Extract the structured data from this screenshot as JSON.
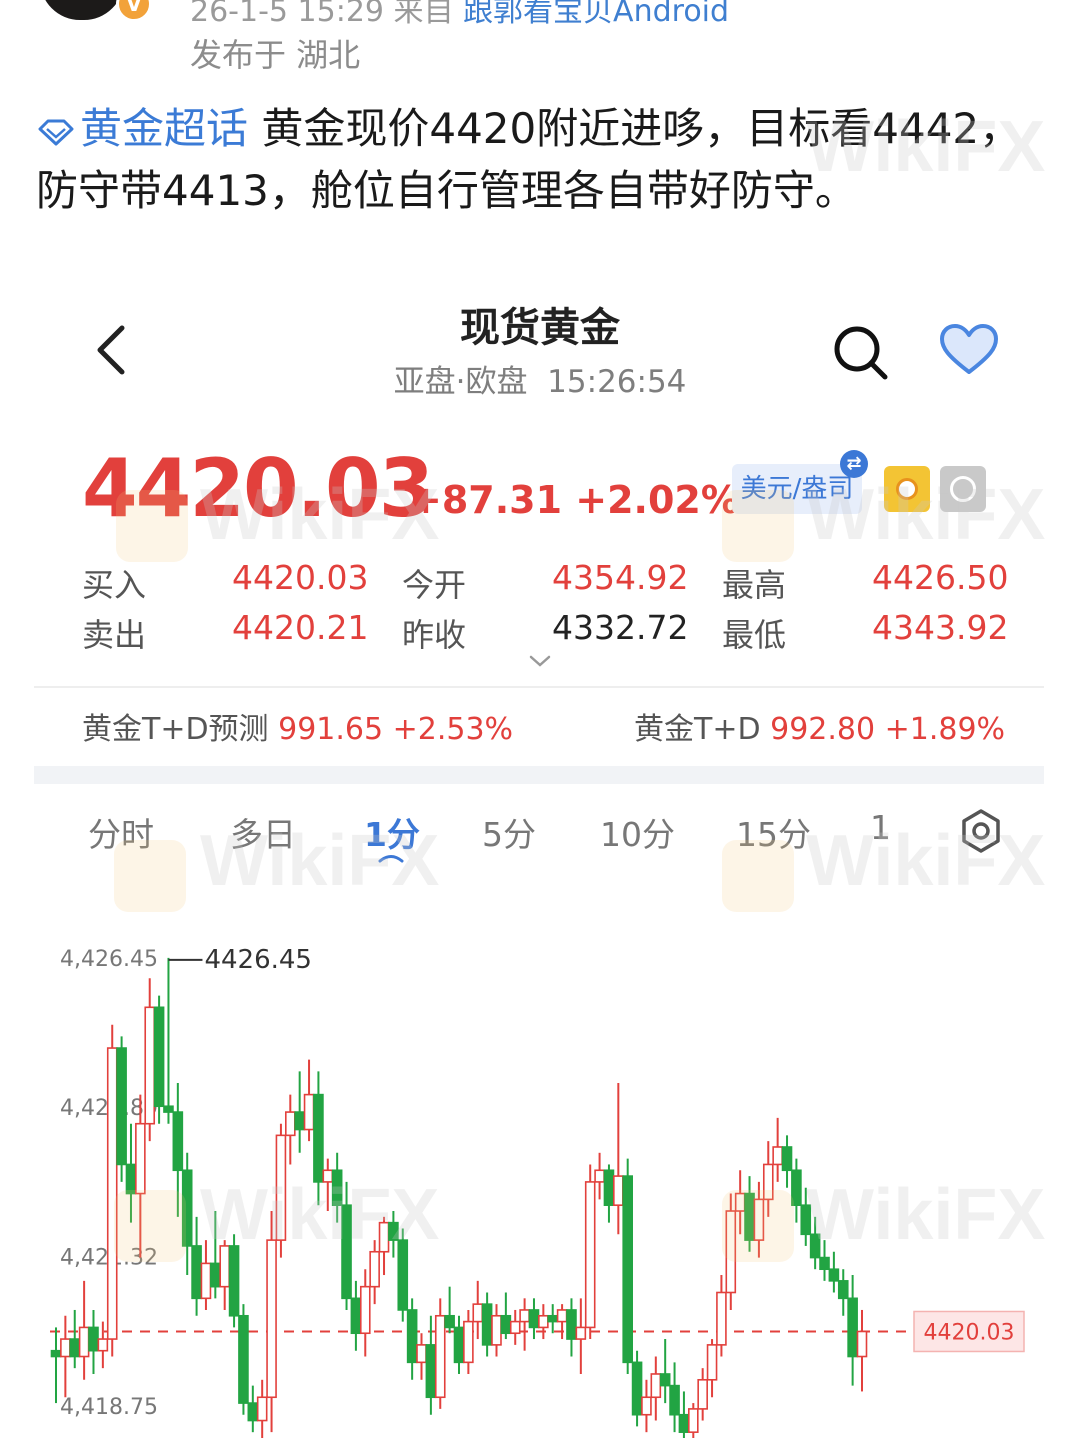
{
  "post": {
    "meta_top_prefix": "26-1-5 15:29  来自 ",
    "meta_top_source": "跟郭看宝贝Android",
    "location": "发布于 湖北",
    "topic": "黄金超话",
    "content": " 黄金现价4420附近进哆，目标看4442，防守带4413，舱位自行管理各自带好防守。"
  },
  "screen": {
    "title": "现货黄金",
    "session": "亚盘·欧盘",
    "time": "15:26:54",
    "price": "4420.03",
    "change": "+87.31 +2.02%",
    "unit": "美元/盎司",
    "quotes": {
      "buy_label": "买入",
      "buy": "4420.03",
      "sell_label": "卖出",
      "sell": "4420.21",
      "open_label": "今开",
      "open": "4354.92",
      "prev_close_label": "昨收",
      "prev_close": "4332.72",
      "high_label": "最高",
      "high": "4426.50",
      "low_label": "最低",
      "low": "4343.92"
    },
    "td_forecast_label": "黄金T+D预测",
    "td_forecast": "991.65 +2.53%",
    "td_label": "黄金T+D",
    "td": "992.80 +1.89%",
    "tabs": [
      "分时",
      "多日",
      "1分",
      "5分",
      "10分",
      "15分",
      "1"
    ],
    "active_tab": "1分"
  },
  "watermark": "WikiFX",
  "colors": {
    "up": "#e2403c",
    "down": "#22a443",
    "accent": "#3c78d6"
  },
  "chart_data": {
    "type": "candlestick",
    "y_ticks": [
      "4,426.45",
      "4,423.89",
      "4,421.32",
      "4,418.75"
    ],
    "ylim": [
      4418.2,
      4427.1
    ],
    "max_label": "4426.45",
    "current_label": "4420.03",
    "current": 4420.03,
    "candles": [
      {
        "o": 4419.7,
        "h": 4420.1,
        "l": 4418.8,
        "c": 4419.6
      },
      {
        "o": 4419.6,
        "h": 4420.3,
        "l": 4418.9,
        "c": 4419.9
      },
      {
        "o": 4419.9,
        "h": 4420.4,
        "l": 4419.4,
        "c": 4419.6
      },
      {
        "o": 4419.6,
        "h": 4420.9,
        "l": 4419.2,
        "c": 4420.1
      },
      {
        "o": 4420.1,
        "h": 4420.4,
        "l": 4419.3,
        "c": 4419.7
      },
      {
        "o": 4419.7,
        "h": 4420.2,
        "l": 4419.4,
        "c": 4419.9
      },
      {
        "o": 4419.9,
        "h": 4425.3,
        "l": 4419.6,
        "c": 4424.9
      },
      {
        "o": 4424.9,
        "h": 4425.1,
        "l": 4422.6,
        "c": 4422.9
      },
      {
        "o": 4422.9,
        "h": 4423.6,
        "l": 4421.9,
        "c": 4422.4
      },
      {
        "o": 4422.4,
        "h": 4424.1,
        "l": 4421.3,
        "c": 4423.6
      },
      {
        "o": 4423.6,
        "h": 4426.1,
        "l": 4423.3,
        "c": 4425.6
      },
      {
        "o": 4425.6,
        "h": 4425.8,
        "l": 4423.6,
        "c": 4423.9
      },
      {
        "o": 4423.9,
        "h": 4426.45,
        "l": 4423.6,
        "c": 4423.8
      },
      {
        "o": 4423.8,
        "h": 4424.3,
        "l": 4422.0,
        "c": 4422.8
      },
      {
        "o": 4422.8,
        "h": 4423.1,
        "l": 4421.0,
        "c": 4421.5
      },
      {
        "o": 4421.5,
        "h": 4422.0,
        "l": 4420.3,
        "c": 4420.6
      },
      {
        "o": 4420.6,
        "h": 4421.6,
        "l": 4420.4,
        "c": 4421.2
      },
      {
        "o": 4421.2,
        "h": 4422.1,
        "l": 4420.6,
        "c": 4420.8
      },
      {
        "o": 4420.8,
        "h": 4421.6,
        "l": 4420.4,
        "c": 4421.5
      },
      {
        "o": 4421.5,
        "h": 4421.7,
        "l": 4420.1,
        "c": 4420.3
      },
      {
        "o": 4420.3,
        "h": 4420.5,
        "l": 4418.6,
        "c": 4418.8
      },
      {
        "o": 4418.8,
        "h": 4419.1,
        "l": 4418.3,
        "c": 4418.5
      },
      {
        "o": 4418.5,
        "h": 4419.2,
        "l": 4418.2,
        "c": 4418.9
      },
      {
        "o": 4418.9,
        "h": 4422.1,
        "l": 4418.3,
        "c": 4421.6
      },
      {
        "o": 4421.6,
        "h": 4423.6,
        "l": 4421.3,
        "c": 4423.4
      },
      {
        "o": 4423.4,
        "h": 4424.1,
        "l": 4422.9,
        "c": 4423.8
      },
      {
        "o": 4423.8,
        "h": 4424.5,
        "l": 4423.1,
        "c": 4423.5
      },
      {
        "o": 4423.5,
        "h": 4424.7,
        "l": 4423.3,
        "c": 4424.1
      },
      {
        "o": 4424.1,
        "h": 4424.5,
        "l": 4422.2,
        "c": 4422.6
      },
      {
        "o": 4422.6,
        "h": 4423.0,
        "l": 4422.1,
        "c": 4422.8
      },
      {
        "o": 4422.8,
        "h": 4423.1,
        "l": 4421.9,
        "c": 4422.2
      },
      {
        "o": 4422.2,
        "h": 4422.6,
        "l": 4420.4,
        "c": 4420.6
      },
      {
        "o": 4420.6,
        "h": 4420.9,
        "l": 4419.7,
        "c": 4420.0
      },
      {
        "o": 4420.0,
        "h": 4421.1,
        "l": 4419.6,
        "c": 4420.8
      },
      {
        "o": 4420.8,
        "h": 4421.6,
        "l": 4420.5,
        "c": 4421.4
      },
      {
        "o": 4421.4,
        "h": 4422.0,
        "l": 4421.0,
        "c": 4421.9
      },
      {
        "o": 4421.9,
        "h": 4422.1,
        "l": 4421.3,
        "c": 4421.6
      },
      {
        "o": 4421.6,
        "h": 4421.8,
        "l": 4420.2,
        "c": 4420.4
      },
      {
        "o": 4420.4,
        "h": 4420.6,
        "l": 4419.2,
        "c": 4419.5
      },
      {
        "o": 4419.5,
        "h": 4420.0,
        "l": 4419.2,
        "c": 4419.8
      },
      {
        "o": 4419.8,
        "h": 4420.3,
        "l": 4418.6,
        "c": 4418.9
      },
      {
        "o": 4418.9,
        "h": 4420.6,
        "l": 4418.7,
        "c": 4420.3
      },
      {
        "o": 4420.3,
        "h": 4420.8,
        "l": 4420.0,
        "c": 4420.1
      },
      {
        "o": 4420.1,
        "h": 4420.3,
        "l": 4419.3,
        "c": 4419.5
      },
      {
        "o": 4419.5,
        "h": 4420.4,
        "l": 4419.3,
        "c": 4420.2
      },
      {
        "o": 4420.2,
        "h": 4420.9,
        "l": 4419.9,
        "c": 4420.5
      },
      {
        "o": 4420.5,
        "h": 4420.7,
        "l": 4419.6,
        "c": 4419.8
      },
      {
        "o": 4419.8,
        "h": 4420.5,
        "l": 4419.6,
        "c": 4420.3
      },
      {
        "o": 4420.3,
        "h": 4420.7,
        "l": 4419.9,
        "c": 4420.0
      },
      {
        "o": 4420.0,
        "h": 4420.4,
        "l": 4419.8,
        "c": 4420.2
      },
      {
        "o": 4420.2,
        "h": 4420.6,
        "l": 4419.7,
        "c": 4420.4
      },
      {
        "o": 4420.4,
        "h": 4420.6,
        "l": 4419.9,
        "c": 4420.1
      },
      {
        "o": 4420.1,
        "h": 4420.5,
        "l": 4419.9,
        "c": 4420.3
      },
      {
        "o": 4420.3,
        "h": 4420.5,
        "l": 4420.0,
        "c": 4420.2
      },
      {
        "o": 4420.2,
        "h": 4420.5,
        "l": 4419.9,
        "c": 4420.4
      },
      {
        "o": 4420.4,
        "h": 4420.6,
        "l": 4419.6,
        "c": 4419.9
      },
      {
        "o": 4419.9,
        "h": 4420.6,
        "l": 4419.3,
        "c": 4420.1
      },
      {
        "o": 4420.1,
        "h": 4422.9,
        "l": 4419.9,
        "c": 4422.6
      },
      {
        "o": 4422.6,
        "h": 4423.1,
        "l": 4422.3,
        "c": 4422.8
      },
      {
        "o": 4422.8,
        "h": 4422.9,
        "l": 4421.9,
        "c": 4422.2
      },
      {
        "o": 4422.2,
        "h": 4424.3,
        "l": 4421.7,
        "c": 4422.7
      },
      {
        "o": 4422.7,
        "h": 4423.0,
        "l": 4419.3,
        "c": 4419.5
      },
      {
        "o": 4419.5,
        "h": 4419.7,
        "l": 4418.4,
        "c": 4418.6
      },
      {
        "o": 4418.6,
        "h": 4419.2,
        "l": 4418.3,
        "c": 4418.9
      },
      {
        "o": 4418.9,
        "h": 4419.6,
        "l": 4418.5,
        "c": 4419.3
      },
      {
        "o": 4419.3,
        "h": 4419.9,
        "l": 4418.8,
        "c": 4419.1
      },
      {
        "o": 4419.1,
        "h": 4419.5,
        "l": 4418.3,
        "c": 4418.6
      },
      {
        "o": 4418.6,
        "h": 4419.0,
        "l": 4418.2,
        "c": 4418.3
      },
      {
        "o": 4418.3,
        "h": 4418.8,
        "l": 4418.2,
        "c": 4418.7
      },
      {
        "o": 4418.7,
        "h": 4419.4,
        "l": 4418.5,
        "c": 4419.2
      },
      {
        "o": 4419.2,
        "h": 4419.9,
        "l": 4418.9,
        "c": 4419.8
      },
      {
        "o": 4419.8,
        "h": 4421.0,
        "l": 4419.6,
        "c": 4420.7
      },
      {
        "o": 4420.7,
        "h": 4422.4,
        "l": 4420.4,
        "c": 4422.1
      },
      {
        "o": 4422.1,
        "h": 4422.8,
        "l": 4421.7,
        "c": 4422.4
      },
      {
        "o": 4422.4,
        "h": 4422.7,
        "l": 4421.4,
        "c": 4421.6
      },
      {
        "o": 4421.6,
        "h": 4422.6,
        "l": 4421.3,
        "c": 4422.3
      },
      {
        "o": 4422.3,
        "h": 4423.3,
        "l": 4422.0,
        "c": 4422.9
      },
      {
        "o": 4422.9,
        "h": 4423.7,
        "l": 4422.6,
        "c": 4423.2
      },
      {
        "o": 4423.2,
        "h": 4423.4,
        "l": 4422.5,
        "c": 4422.8
      },
      {
        "o": 4422.8,
        "h": 4423.0,
        "l": 4421.9,
        "c": 4422.2
      },
      {
        "o": 4422.2,
        "h": 4422.5,
        "l": 4421.5,
        "c": 4421.7
      },
      {
        "o": 4421.7,
        "h": 4422.0,
        "l": 4421.1,
        "c": 4421.3
      },
      {
        "o": 4421.3,
        "h": 4421.6,
        "l": 4420.9,
        "c": 4421.1
      },
      {
        "o": 4421.1,
        "h": 4421.4,
        "l": 4420.7,
        "c": 4420.9
      },
      {
        "o": 4420.9,
        "h": 4421.1,
        "l": 4420.3,
        "c": 4420.6
      },
      {
        "o": 4420.6,
        "h": 4421.0,
        "l": 4419.1,
        "c": 4419.6
      },
      {
        "o": 4419.6,
        "h": 4420.4,
        "l": 4419.0,
        "c": 4420.03
      }
    ]
  }
}
